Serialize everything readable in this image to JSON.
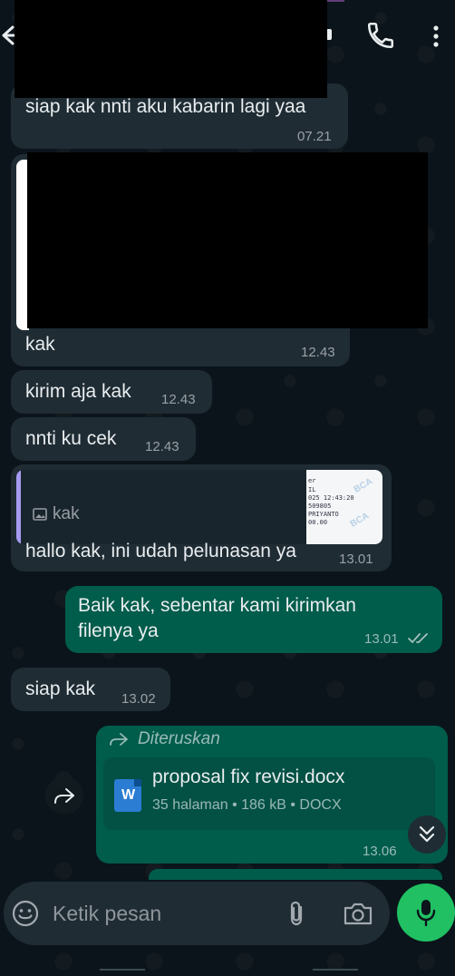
{
  "input": {
    "placeholder": "Ketik pesan"
  },
  "messages": [
    {
      "text": "siap kak nnti aku kabarin lagi yaa",
      "time": "07.21"
    },
    {
      "text": "kak",
      "time": "12.43"
    },
    {
      "text": "kirim aja kak",
      "time": "12.43"
    },
    {
      "text": "nnti ku cek",
      "time": "12.43"
    },
    {
      "quote_label": "kak",
      "text": "hallo kak, ini udah pelunasan ya",
      "time": "13.01",
      "thumb_lines": [
        "er",
        "IL",
        "025 12:43:20",
        "509805",
        "PRIYANTO",
        "00.00"
      ],
      "thumb_watermark": "BCA"
    },
    {
      "text_line1": "Baik kak, sebentar kami kirimkan",
      "text_line2": "filenya ya",
      "time": "13.01",
      "status": "read"
    },
    {
      "text": "siap kak",
      "time": "13.02"
    },
    {
      "forwarded_label": "Diteruskan",
      "doc_name": "proposal fix revisi.docx",
      "doc_meta": "35 halaman • 186 kB • DOCX",
      "doc_icon": "W",
      "time": "13.06"
    }
  ],
  "colors": {
    "incoming": "#1f2c34",
    "outgoing": "#005c4b",
    "accent": "#21c063",
    "background": "#0b141a"
  },
  "icons": [
    "back-arrow-icon",
    "phone-icon",
    "more-vert-icon",
    "image-icon",
    "forward-icon",
    "word-doc-icon",
    "double-check-icon",
    "chevron-double-down-icon",
    "emoji-icon",
    "paperclip-icon",
    "camera-icon",
    "mic-icon"
  ]
}
